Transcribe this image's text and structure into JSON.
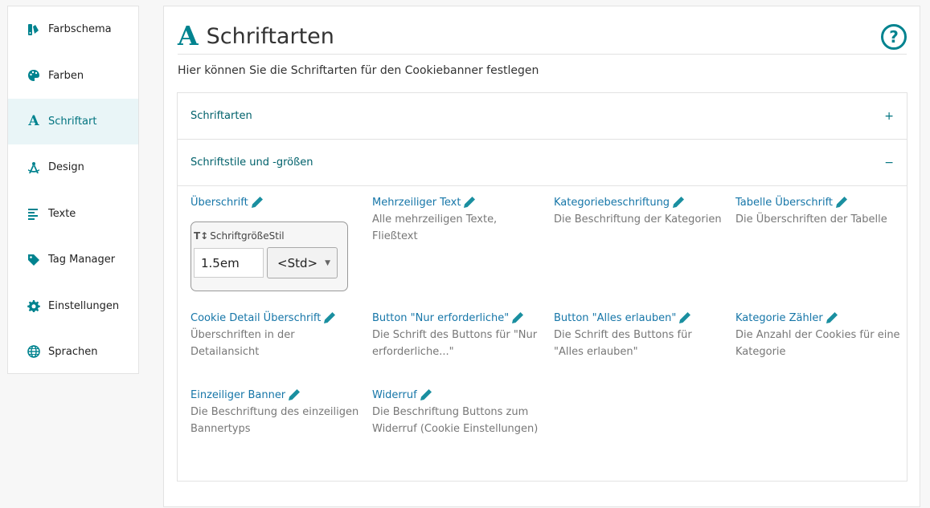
{
  "sidebar": {
    "items": [
      {
        "label": "Farbschema",
        "icon": "swatches-icon"
      },
      {
        "label": "Farben",
        "icon": "palette-icon"
      },
      {
        "label": "Schriftart",
        "icon": "font-icon",
        "active": true
      },
      {
        "label": "Design",
        "icon": "drafting-compass-icon"
      },
      {
        "label": "Texte",
        "icon": "align-left-icon"
      },
      {
        "label": "Tag Manager",
        "icon": "tag-icon"
      },
      {
        "label": "Einstellungen",
        "icon": "gear-icon"
      },
      {
        "label": "Sprachen",
        "icon": "globe-icon"
      }
    ]
  },
  "header": {
    "title": "Schriftarten",
    "title_icon": "A",
    "help_glyph": "?",
    "subtitle": "Hier können Sie die Schriftarten für den Cookiebanner festlegen"
  },
  "accordion": {
    "section1": {
      "label": "Schriftarten",
      "toggle": "+"
    },
    "section2": {
      "label": "Schriftstile und -größen",
      "toggle": "−"
    }
  },
  "styles": [
    {
      "title": "Überschrift",
      "desc": ""
    },
    {
      "title": "Mehrzeiliger Text",
      "desc": "Alle mehrzeiligen Texte, Fließtext"
    },
    {
      "title": "Kategoriebeschriftung",
      "desc": "Die Beschriftung der Kategorien"
    },
    {
      "title": "Tabelle Überschrift",
      "desc": "Die Überschriften der Tabelle"
    },
    {
      "title": "Cookie Detail Überschrift",
      "desc": "Überschriften in der Detailansicht"
    },
    {
      "title": "Button \"Nur erforderliche\"",
      "desc": "Die Schrift des Buttons für \"Nur erforderliche...\""
    },
    {
      "title": "Button \"Alles erlauben\"",
      "desc": "Die Schrift des Buttons für \"Alles erlauben\""
    },
    {
      "title": "Kategorie Zähler",
      "desc": "Die Anzahl der Cookies für eine Kategorie"
    },
    {
      "title": "Einzeiliger Banner",
      "desc": "Die Beschriftung des einzeiligen Bannertyps"
    },
    {
      "title": "Widerruf",
      "desc": "Die Beschriftung Buttons zum Widerruf (Cookie Einstellungen)"
    }
  ],
  "editor": {
    "icon_glyph": "T↕",
    "size_label": "Schriftgröße",
    "style_label": "Stil",
    "size_value": "1.5em",
    "style_value": "<Std>",
    "caret": "▼"
  },
  "colors": {
    "accent": "#00838f",
    "link": "#1676a8",
    "active_bg": "#e9f5f7"
  }
}
